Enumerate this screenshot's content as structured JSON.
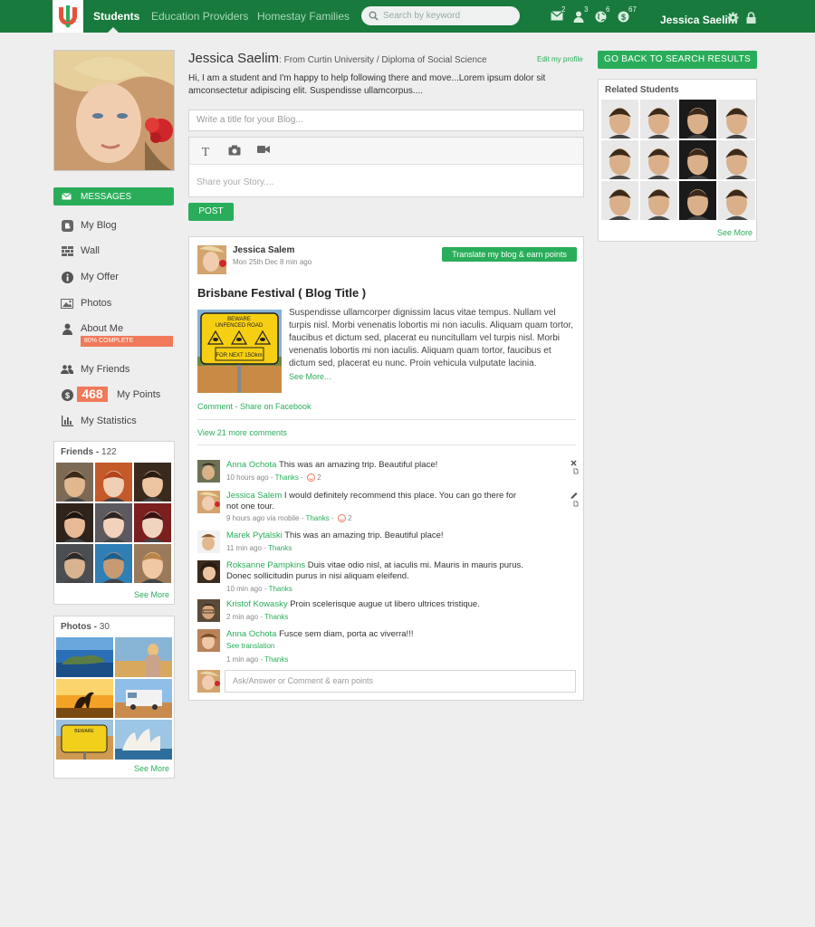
{
  "nav": {
    "items": [
      {
        "label": "Students",
        "active": true
      },
      {
        "label": "Education Providers",
        "active": false
      },
      {
        "label": "Homestay Families",
        "active": false
      }
    ],
    "search_placeholder": "Search by keyword",
    "notifications": [
      {
        "icon": "mail-icon",
        "count": "2"
      },
      {
        "icon": "person-icon",
        "count": "3"
      },
      {
        "icon": "globe-icon",
        "count": "6"
      },
      {
        "icon": "dollar-icon",
        "count": "67"
      }
    ],
    "user_name": "Jessica Saelim"
  },
  "colors": {
    "topbar": "#187a3d",
    "accent": "#2aad5a",
    "orange": "#f07a5a",
    "background": "#eeeeee"
  },
  "sidebar": {
    "messages_label": "MESSAGES",
    "items": [
      {
        "icon": "blogger-icon",
        "label": "My Blog"
      },
      {
        "icon": "wall-icon",
        "label": "Wall"
      },
      {
        "icon": "info-icon",
        "label": "My Offer"
      },
      {
        "icon": "photo-icon",
        "label": "Photos"
      },
      {
        "icon": "user-icon",
        "label": "About Me"
      },
      {
        "icon": "friends-icon",
        "label": "My Friends"
      },
      {
        "icon": "coin-icon",
        "label": "My Points"
      },
      {
        "icon": "statistics-icon",
        "label": "My Statistics"
      }
    ],
    "about_badge": "80% COMPLETE",
    "points": "468",
    "friends": {
      "title": "Friends",
      "count": "122",
      "see_more": "See More"
    },
    "photos": {
      "title": "Photos",
      "count": "30",
      "see_more": "See More"
    }
  },
  "profile": {
    "name": "Jessica Saelim",
    "subtitle": ": From Curtin University / Diploma of Social Science",
    "edit_link": "Edit my profile",
    "bio": "Hi, I am a student and I'm happy to help following there and move...Lorem ipsum dolor sit amconsectetur adipiscing elit. Suspendisse ullamcorpus...."
  },
  "composer": {
    "title_placeholder": "Write a title for your Blog...",
    "story_placeholder": "Share your Story....",
    "post_label": "POST"
  },
  "blog": {
    "author": "Jessica Salem",
    "date": "Mon 25th Dec 8 min ago",
    "translate_label": "Translate my blog & earn points",
    "title": "Brisbane Festival ( Blog Title )",
    "body": "Suspendisse ullamcorper dignissim lacus vitae tempus. Nullam vel turpis nisl. Morbi venenatis lobortis mi non iaculis. Aliquam quam tortor, faucibus et dictum sed, placerat eu nuncitullam vel turpis nisl. Morbi venenatis lobortis mi non iaculis. Aliquam quam tortor, faucibus et dictum sed, placerat eu nunc. Proin vehicula vulputate lacinia.",
    "see_more": "See More...",
    "comment_share": "Comment - Share on Facebook",
    "image_sign": [
      "BEWARE",
      "UNFENCED ROAD",
      "FOR NEXT 15Okm"
    ],
    "view_more_comments": "View 21 more comments"
  },
  "comments": [
    {
      "author": "Anna Ochota",
      "text": "This was an amazing trip. Beautiful place!",
      "meta": "10 hours ago",
      "thanks": "Thanks",
      "smiles": "2",
      "action": "close-icon"
    },
    {
      "author": "Jessica Salem",
      "text": "I would definitely recommend this place. You can go there for not one tour.",
      "meta": "9 hours ago via mobile",
      "thanks": "Thanks",
      "smiles": "2",
      "action": "edit-icon"
    },
    {
      "author": "Marek Pytalski",
      "text": "This was an amazing trip. Beautiful place!",
      "meta": "11 min ago",
      "thanks": "Thanks"
    },
    {
      "author": "Roksanne Pampkins",
      "text": "Duis vitae odio nisl, at iaculis mi. Mauris in mauris purus. Donec sollicitudin purus in nisi aliquam eleifend.",
      "meta": "10 min ago",
      "thanks": "Thanks"
    },
    {
      "author": "Kristof Kowasky",
      "text": "Proin scelerisque augue ut libero ultrices tristique.",
      "meta": "2 min ago",
      "thanks": "Thanks"
    },
    {
      "author": "Anna Ochota",
      "text": "Fusce sem diam, porta ac viverra!!!",
      "meta": "1 min ago",
      "thanks": "Thanks",
      "translation": "See translation"
    }
  ],
  "reply_placeholder": "Ask/Answer or Comment & earn points",
  "right": {
    "back_label": "GO BACK TO SEARCH RESULTS",
    "related_title": "Related Students",
    "see_more": "See More"
  }
}
